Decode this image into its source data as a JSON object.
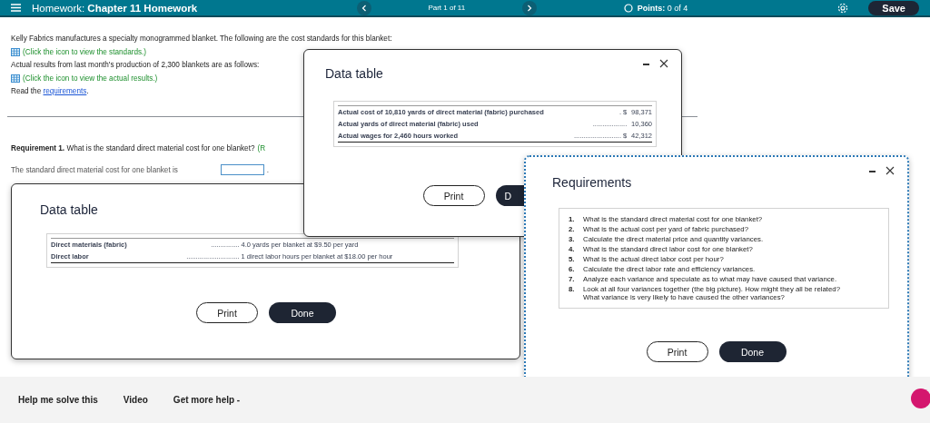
{
  "header": {
    "title": "Homework: **Chapter 11 Homework**",
    "part": "Part 1 of 11",
    "points": "**Points:** 0 of 4",
    "save": "Save"
  },
  "problem": {
    "intro": "Kelly Fabrics manufactures a specialty monogrammed blanket. The following are the cost standards for this blanket:",
    "standards_link": "(Click the icon to view the standards.)",
    "actual_intro": "Actual results from last month's production of 2,300 blankets are as follows:",
    "actual_link": "(Click the icon to view the actual results.)",
    "read_text": "Read the",
    "read_link": "requirements",
    "read_end": ".",
    "requirement_label": "Requirement 1.",
    "requirement_question": "What is the standard direct material cost for one blanket?",
    "requirement_hint": "(R",
    "answer_prompt": "The standard direct material cost for one blanket is",
    "answer_end": "."
  },
  "dialogs": [
    {
      "kind": "table",
      "title": "Data table",
      "rows": [
        {
          "label": "Direct materials (fabric)",
          "leader": "...............",
          "value": "4.0 yards per blanket at $9.50 per yard"
        },
        {
          "label": "Direct labor",
          "leader": "............................",
          "value": "1 direct labor hours per blanket at $18.00 per hour"
        }
      ],
      "buttons": [
        {
          "label": "Print",
          "kind": "outline"
        },
        {
          "label": "Done",
          "kind": "solid"
        }
      ]
    },
    {
      "kind": "table",
      "title": "Data table",
      "rows": [
        {
          "label": "Actual cost of 10,810 yards of direct material (fabric) purchased",
          "leader": ". $",
          "value": "98,371"
        },
        {
          "label": "Actual yards of direct material (fabric) used",
          "leader": "..................",
          "value": "10,360"
        },
        {
          "label": "Actual wages for 2,460 hours worked",
          "leader": "......................... $",
          "value": "42,312"
        }
      ],
      "buttons": [
        {
          "label": "Print",
          "kind": "outline"
        },
        {
          "label": "D",
          "kind": "solid"
        }
      ]
    },
    {
      "kind": "list",
      "title": "Requirements",
      "items": [
        {
          "number": "1.",
          "text": "What is the standard direct material cost for one blanket?"
        },
        {
          "number": "2.",
          "text": "What is the actual cost per yard of fabric purchased?"
        },
        {
          "number": "3.",
          "text": "Calculate the direct material price and quantity variances."
        },
        {
          "number": "4.",
          "text": "What is the standard direct labor cost for one blanket?"
        },
        {
          "number": "5.",
          "text": "What is the actual direct labor cost per hour?"
        },
        {
          "number": "6.",
          "text": "Calculate the direct labor rate and efficiency variances."
        },
        {
          "number": "7.",
          "text": "Analyze each variance and speculate as to what may have caused that variance."
        },
        {
          "number": "8.",
          "text": "Look at all four variances together (the big picture). How might they all be related? What variance is very likely to have caused the other variances?"
        }
      ],
      "buttons": [
        {
          "label": "Print",
          "kind": "outline"
        },
        {
          "label": "Done",
          "kind": "solid"
        }
      ]
    }
  ],
  "footer": {
    "items": [
      "Help me solve this",
      "Video",
      "Get more help -"
    ]
  }
}
